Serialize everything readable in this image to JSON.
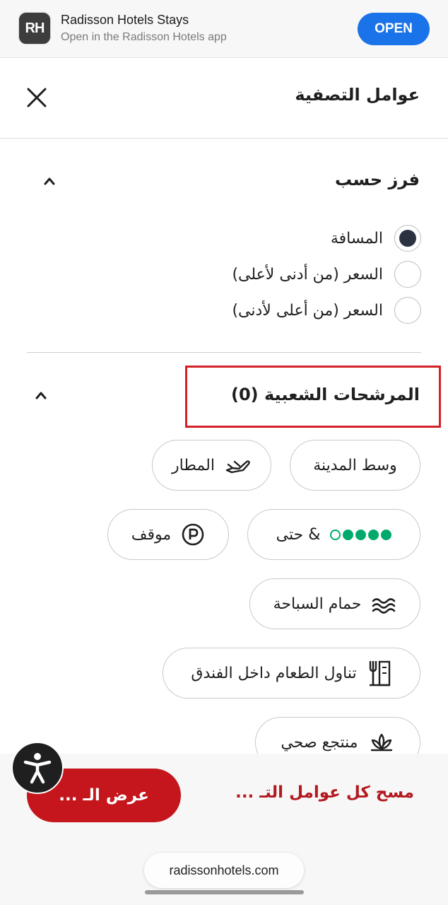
{
  "banner": {
    "icon_text": "RH",
    "title": "Radisson Hotels Stays",
    "subtitle": "Open in the Radisson Hotels app",
    "open_label": "OPEN"
  },
  "header": {
    "title": "عوامل التصفية"
  },
  "sort": {
    "title": "فرز حسب",
    "options": [
      {
        "label": "المسافة",
        "checked": true
      },
      {
        "label": "السعر (من أدنى لأعلى)",
        "checked": false
      },
      {
        "label": "السعر (من أعلى لأدنى)",
        "checked": false
      }
    ]
  },
  "popular": {
    "title": "المرشحات الشعبية (0)",
    "chips": [
      {
        "label": "وسط المدينة",
        "icon": "none"
      },
      {
        "label": "المطار",
        "icon": "airplane-icon"
      },
      {
        "label": "& حتى",
        "icon": "rating-bubbles-icon",
        "rating": 4,
        "rating_max": 5
      },
      {
        "label": "موقف",
        "icon": "parking-icon"
      },
      {
        "label": "حمام السباحة",
        "icon": "pool-icon"
      },
      {
        "label": "تناول الطعام داخل الفندق",
        "icon": "dining-icon"
      },
      {
        "label": "منتجع صحي",
        "icon": "spa-lotus-icon"
      }
    ]
  },
  "footer": {
    "show_label": "عرض الـ ...",
    "clear_label": "مسح كل عوامل التـ ..."
  },
  "browser": {
    "url": "radissonhotels.com"
  },
  "colors": {
    "brand_red": "#c4161c",
    "open_blue": "#1a73e8",
    "rating_green": "#00aa6c",
    "highlight_red": "#d42027"
  }
}
